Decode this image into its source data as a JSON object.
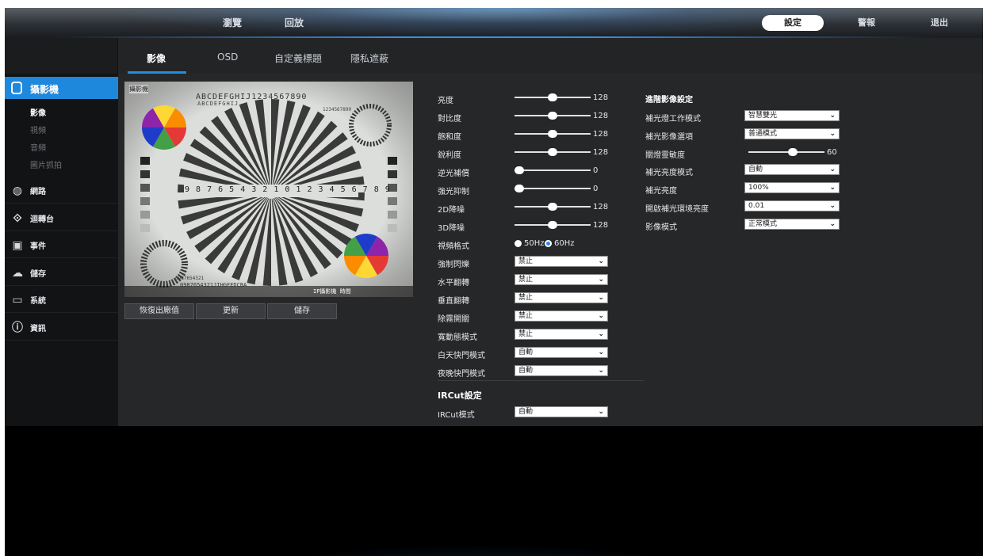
{
  "topbar": {
    "browse": "瀏覽",
    "playback": "回放",
    "settings": "設定",
    "alarm": "警報",
    "logout": "退出"
  },
  "tabs": [
    "影像",
    "OSD",
    "自定義標題",
    "隱私遮蔽"
  ],
  "sidebar": {
    "camera": "攝影機",
    "sub": [
      "影像",
      "視頻",
      "音頻",
      "圖片抓拍"
    ],
    "items": [
      {
        "label": "網路",
        "icon": "globe-icon"
      },
      {
        "label": "迴轉台",
        "icon": "ptz-icon"
      },
      {
        "label": "事件",
        "icon": "event-icon"
      },
      {
        "label": "儲存",
        "icon": "storage-icon"
      },
      {
        "label": "系統",
        "icon": "monitor-icon"
      },
      {
        "label": "資訊",
        "icon": "info-icon"
      }
    ]
  },
  "video": {
    "osd_top": "攝影機",
    "chart_row1": "ABCDEFGHIJ1234567890",
    "chart_row2": "ABCDEFGHIJ",
    "chart_row3": "1234567890",
    "chart_numbers": "9 8 7 6 5 4 3 2 1 0 1 2 3 4 5 6 7 8 9",
    "chart_bottom1": "0987654321",
    "chart_bottom2": "0987654321JIHGFEDCBA",
    "osd_bottom": "IP攝影機 時間"
  },
  "buttons": {
    "factory": "恢復出廠值",
    "refresh": "更新",
    "save": "儲存"
  },
  "image_settings": {
    "brightness": {
      "label": "亮度",
      "value": "128",
      "fraction": 0.5
    },
    "contrast": {
      "label": "對比度",
      "value": "128",
      "fraction": 0.5
    },
    "saturation": {
      "label": "飽和度",
      "value": "128",
      "fraction": 0.5
    },
    "sharpness": {
      "label": "銳利度",
      "value": "128",
      "fraction": 0.5
    },
    "blc": {
      "label": "逆光補償",
      "value": "0",
      "fraction": 0
    },
    "hlc": {
      "label": "強光抑制",
      "value": "0",
      "fraction": 0
    },
    "dnr2d": {
      "label": "2D降噪",
      "value": "128",
      "fraction": 0.5
    },
    "dnr3d": {
      "label": "3D降噪",
      "value": "128",
      "fraction": 0.5
    },
    "video_format": {
      "label": "視頻格式",
      "opt1": "50Hz",
      "opt2": "60Hz",
      "selected": "60Hz"
    },
    "flicker": {
      "label": "強制閃爍",
      "value": "禁止"
    },
    "mirror_h": {
      "label": "水平翻轉",
      "value": "禁止"
    },
    "mirror_v": {
      "label": "垂直翻轉",
      "value": "禁止"
    },
    "defog": {
      "label": "除霧開關",
      "value": "禁止"
    },
    "wdr": {
      "label": "寬動態模式",
      "value": "禁止"
    },
    "day_shutter": {
      "label": "白天快門模式",
      "value": "自動"
    },
    "night_shutter": {
      "label": "夜晚快門模式",
      "value": "自動"
    }
  },
  "ircut": {
    "title": "IRCut設定",
    "mode_label": "IRCut模式",
    "mode_value": "自動"
  },
  "advanced": {
    "title": "進階影像設定",
    "fill_mode": {
      "label": "補光燈工作模式",
      "value": "智慧雙光"
    },
    "fill_image": {
      "label": "補光影像選項",
      "value": "普通模式"
    },
    "light_sensitivity": {
      "label": "關燈靈敏度",
      "value": "60",
      "fraction": 0.6
    },
    "fill_brightness_mode": {
      "label": "補光亮度模式",
      "value": "自動"
    },
    "fill_brightness": {
      "label": "補光亮度",
      "value": "100%"
    },
    "fill_env_brightness": {
      "label": "開啟補光環境亮度",
      "value": "0.01"
    },
    "image_mode": {
      "label": "影像模式",
      "value": "正常模式"
    }
  },
  "colors": {
    "accent": "#1e88dd",
    "radio_selected": "#2f8be6"
  }
}
